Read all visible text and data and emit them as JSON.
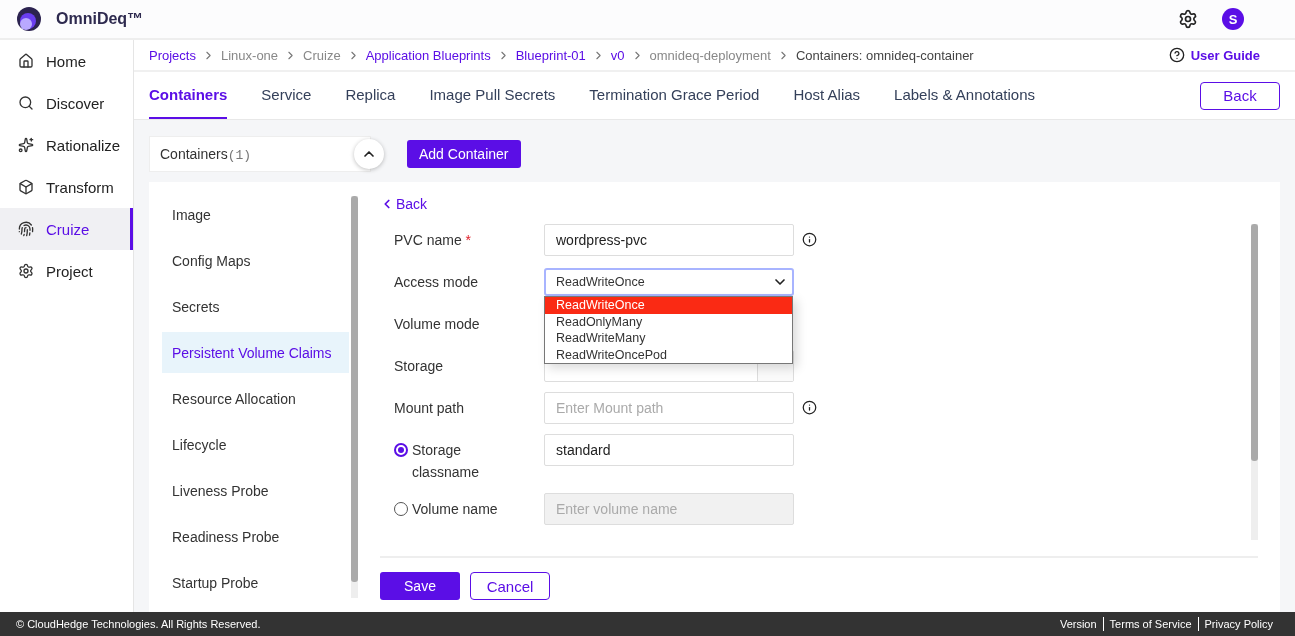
{
  "app": {
    "name": "OmniDeq™"
  },
  "header": {
    "avatar_letter": "S"
  },
  "sidebar": {
    "items": [
      {
        "label": "Home",
        "selected": false
      },
      {
        "label": "Discover",
        "selected": false
      },
      {
        "label": "Rationalize",
        "selected": false
      },
      {
        "label": "Transform",
        "selected": false
      },
      {
        "label": "Cruize",
        "selected": true
      },
      {
        "label": "Project",
        "selected": false
      }
    ]
  },
  "breadcrumb": [
    {
      "label": "Projects",
      "kind": "link"
    },
    {
      "label": "Linux-one",
      "kind": "plain"
    },
    {
      "label": "Cruize",
      "kind": "plain"
    },
    {
      "label": "Application Blueprints",
      "kind": "link"
    },
    {
      "label": "Blueprint-01",
      "kind": "link"
    },
    {
      "label": "v0",
      "kind": "link"
    },
    {
      "label": "omnideq-deployment",
      "kind": "plain"
    },
    {
      "label": "Containers: omnideq-container",
      "kind": "current"
    }
  ],
  "user_guide": "User Guide",
  "tabs": [
    {
      "label": "Containers",
      "selected": true
    },
    {
      "label": "Service",
      "selected": false
    },
    {
      "label": "Replica",
      "selected": false
    },
    {
      "label": "Image Pull Secrets",
      "selected": false
    },
    {
      "label": "Termination Grace Period",
      "selected": false
    },
    {
      "label": "Host Alias",
      "selected": false
    },
    {
      "label": "Labels & Annotations",
      "selected": false
    }
  ],
  "back_button": "Back",
  "containers_panel": {
    "label": "Containers",
    "count": "(1)",
    "expanded": true
  },
  "add_container_button": "Add Container",
  "section_nav": [
    {
      "label": "Image",
      "selected": false
    },
    {
      "label": "Config Maps",
      "selected": false
    },
    {
      "label": "Secrets",
      "selected": false
    },
    {
      "label": "Persistent Volume Claims",
      "selected": true
    },
    {
      "label": "Resource Allocation",
      "selected": false
    },
    {
      "label": "Lifecycle",
      "selected": false
    },
    {
      "label": "Liveness Probe",
      "selected": false
    },
    {
      "label": "Readiness Probe",
      "selected": false
    },
    {
      "label": "Startup Probe",
      "selected": false
    }
  ],
  "form": {
    "back_link": "Back",
    "fields": [
      {
        "kind": "text",
        "label": "PVC name",
        "required_mark": "*",
        "value": "wordpress-pvc",
        "info": true
      },
      {
        "kind": "select",
        "label": "Access mode",
        "value": "ReadWriteOnce",
        "open": true,
        "options": [
          {
            "label": "ReadWriteOnce",
            "selected": true
          },
          {
            "label": "ReadOnlyMany",
            "selected": false
          },
          {
            "label": "ReadWriteMany",
            "selected": false
          },
          {
            "label": "ReadWriteOncePod",
            "selected": false
          }
        ]
      },
      {
        "kind": "label",
        "label": "Volume mode"
      },
      {
        "kind": "storage",
        "label": "Storage"
      },
      {
        "kind": "text",
        "label": "Mount path",
        "placeholder": "Enter Mount path",
        "info": true
      },
      {
        "kind": "radio",
        "label": "Storage classname",
        "selected": true,
        "value": "standard",
        "disabled": false
      },
      {
        "kind": "radio",
        "label": "Volume name",
        "selected": false,
        "placeholder": "Enter volume name",
        "disabled": true
      }
    ],
    "save_button": "Save",
    "cancel_button": "Cancel"
  },
  "footer": {
    "copyright": "© CloudHedge Technologies. All Rights Reserved.",
    "links": [
      "Version",
      "Terms of Service",
      "Privacy Policy"
    ]
  }
}
